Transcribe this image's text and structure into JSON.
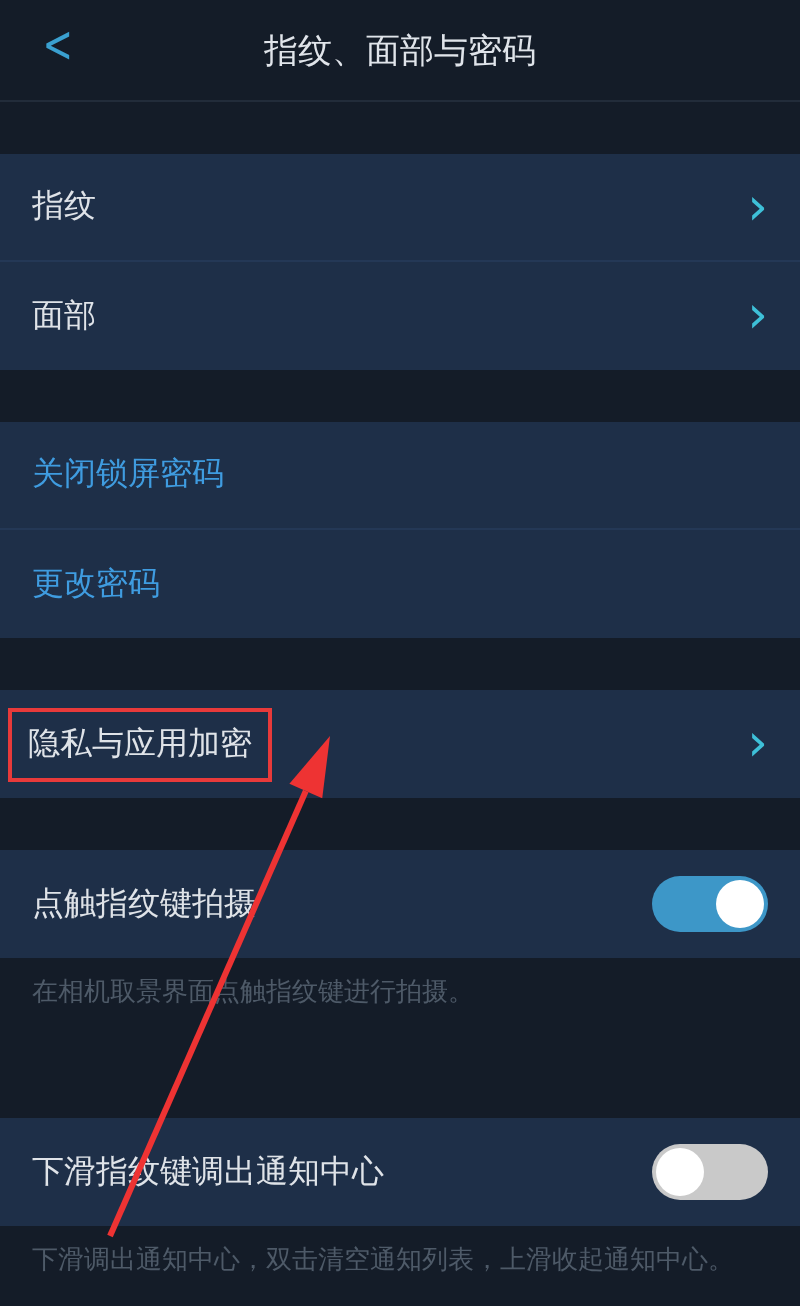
{
  "header": {
    "back": "<",
    "title": "指纹、面部与密码"
  },
  "sections": [
    {
      "items": [
        {
          "kind": "nav",
          "label": "指纹",
          "chevron": "›",
          "highlighted": false
        },
        {
          "kind": "nav",
          "label": "面部",
          "chevron": "›",
          "highlighted": false
        }
      ]
    },
    {
      "items": [
        {
          "kind": "link",
          "label": "关闭锁屏密码"
        },
        {
          "kind": "link",
          "label": "更改密码"
        }
      ]
    },
    {
      "items": [
        {
          "kind": "nav",
          "label": "隐私与应用加密",
          "chevron": "›",
          "highlighted": true
        }
      ]
    },
    {
      "items": [
        {
          "kind": "toggle",
          "label": "点触指纹键拍摄",
          "on": true
        }
      ],
      "description": "在相机取景界面点触指纹键进行拍摄。"
    },
    {
      "items": [
        {
          "kind": "toggle",
          "label": "下滑指纹键调出通知中心",
          "on": false
        }
      ],
      "description": "下滑调出通知中心，双击清空通知列表，上滑收起通知中心。"
    }
  ]
}
